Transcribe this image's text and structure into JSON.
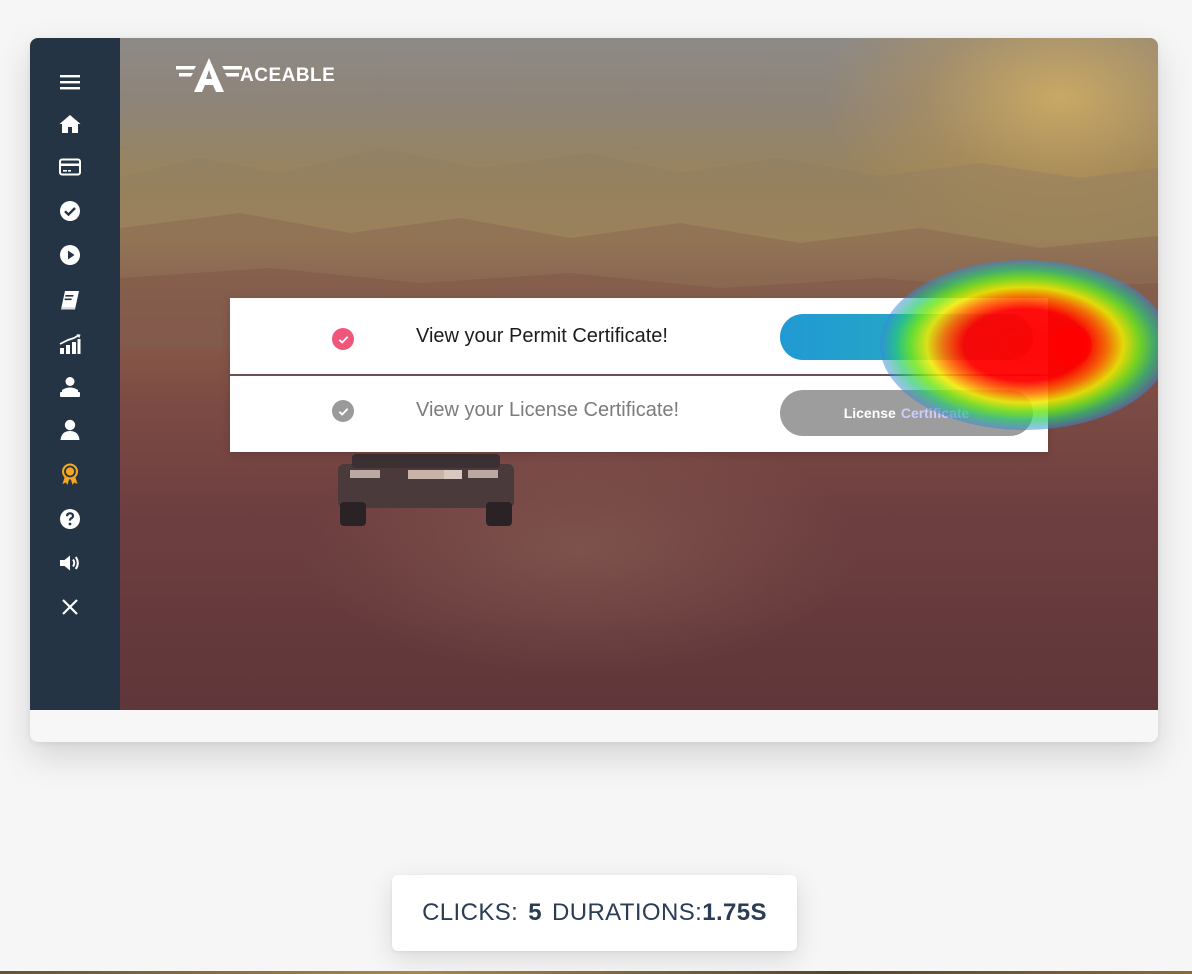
{
  "brand": {
    "logo_text": "ACEABLE"
  },
  "sidebar": {
    "items": [
      {
        "icon": "menu-icon"
      },
      {
        "icon": "home-icon"
      },
      {
        "icon": "payment-card-icon"
      },
      {
        "icon": "check-circle-icon"
      },
      {
        "icon": "play-circle-icon"
      },
      {
        "icon": "book-icon"
      },
      {
        "icon": "progress-chart-icon"
      },
      {
        "icon": "instructor-icon"
      },
      {
        "icon": "user-icon"
      },
      {
        "icon": "certificate-award-icon",
        "active": true,
        "color": "#f5a623"
      },
      {
        "icon": "help-icon"
      },
      {
        "icon": "volume-icon"
      },
      {
        "icon": "close-icon"
      }
    ]
  },
  "certificates": {
    "rows": [
      {
        "label": "View your Permit Certificate!",
        "button_label": "",
        "status": "complete",
        "check_color": "#f0567a"
      },
      {
        "label": "View your License Certificate!",
        "button_label_bold": "License",
        "button_label_rest": "Certificate",
        "status": "disabled",
        "check_color": "#9a9a9a"
      }
    ]
  },
  "stats": {
    "clicks_label": "CLICKS:",
    "clicks_value": "5",
    "duration_label": "DURATIONS:",
    "duration_value": "1.75S"
  },
  "colors": {
    "sidebar_bg": "#243444",
    "active_icon": "#f5a623",
    "primary_button": "#2199d4",
    "disabled_button": "#9d9d9d",
    "stats_text": "#2b3d55"
  }
}
